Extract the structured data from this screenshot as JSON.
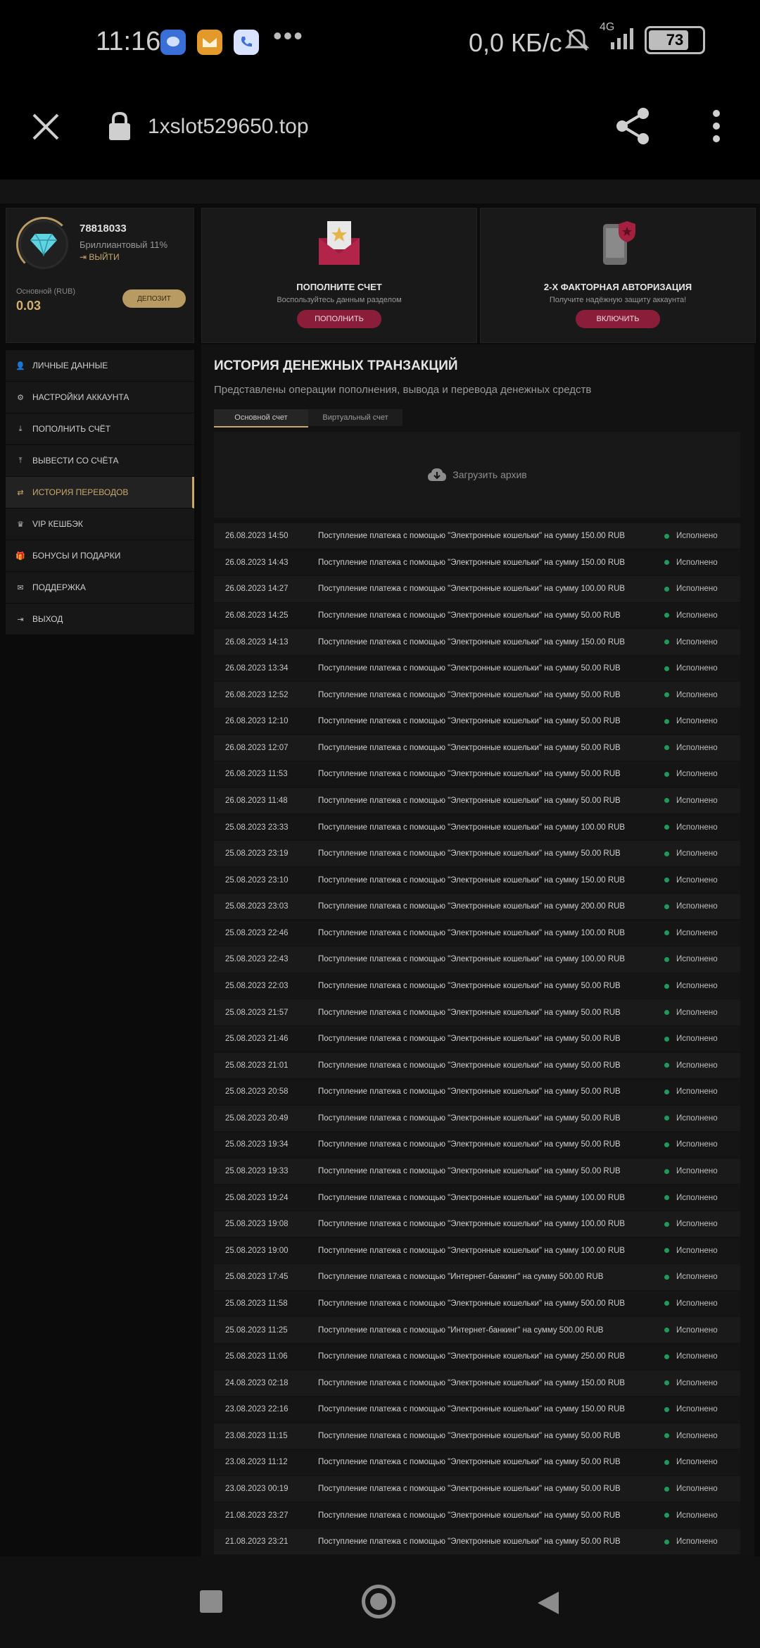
{
  "status_bar": {
    "time": "11:16",
    "network_speed": "0,0 КБ/с",
    "network_type": "4G",
    "battery": "73",
    "more": "•••"
  },
  "browser": {
    "url": "1xslot529650.top"
  },
  "profile": {
    "id": "78818033",
    "level": "Бриллиантовый 11%",
    "logout": "ВЫЙТИ",
    "balance_label": "Основной (RUB)",
    "balance": "0.03",
    "deposit_label": "ДЕПОЗИТ"
  },
  "menu": [
    {
      "label": "ЛИЧНЫЕ ДАННЫЕ",
      "icon": "user-icon",
      "glyph": "👤"
    },
    {
      "label": "НАСТРОЙКИ АККАУНТА",
      "icon": "gears-icon",
      "glyph": "⚙"
    },
    {
      "label": "ПОПОЛНИТЬ СЧЁТ",
      "icon": "download-icon",
      "glyph": "⤓"
    },
    {
      "label": "ВЫВЕСТИ СО СЧЁТА",
      "icon": "upload-icon",
      "glyph": "⤒"
    },
    {
      "label": "ИСТОРИЯ ПЕРЕВОДОВ",
      "icon": "transfer-icon",
      "glyph": "⇄"
    },
    {
      "label": "VIP КЕШБЭК",
      "icon": "crown-icon",
      "glyph": "♛"
    },
    {
      "label": "БОНУСЫ И ПОДАРКИ",
      "icon": "gift-icon",
      "glyph": "🎁"
    },
    {
      "label": "ПОДДЕРЖКА",
      "icon": "mail-icon",
      "glyph": "✉"
    },
    {
      "label": "ВЫХОД",
      "icon": "exit-icon",
      "glyph": "⇥"
    }
  ],
  "promo_deposit": {
    "title": "ПОПОЛНИТЕ СЧЕТ",
    "subtitle": "Воспользуйтесь данным разделом",
    "button": "ПОПОЛНИТЬ"
  },
  "promo_2fa": {
    "title": "2-Х ФАКТОРНАЯ АВТОРИЗАЦИЯ",
    "subtitle": "Получите надёжную защиту аккаунта!",
    "button": "ВКЛЮЧИТЬ"
  },
  "history": {
    "title": "ИСТОРИЯ ДЕНЕЖНЫХ ТРАНЗАКЦИЙ",
    "subtitle": "Представлены операции пополнения, вывода и перевода денежных средств",
    "tabs": [
      "Основной счет",
      "Виртуальный счет"
    ],
    "archive": "Загрузить архив",
    "status_color": "#1f9a5a",
    "rows": [
      {
        "date": "26.08.2023 14:50",
        "desc": "Поступление платежа с помощью \"Электронные кошельки\" на сумму 150.00 RUB",
        "status": "Исполнено"
      },
      {
        "date": "26.08.2023 14:43",
        "desc": "Поступление платежа с помощью \"Электронные кошельки\" на сумму 150.00 RUB",
        "status": "Исполнено"
      },
      {
        "date": "26.08.2023 14:27",
        "desc": "Поступление платежа с помощью \"Электронные кошельки\" на сумму 100.00 RUB",
        "status": "Исполнено"
      },
      {
        "date": "26.08.2023 14:25",
        "desc": "Поступление платежа с помощью \"Электронные кошельки\" на сумму 50.00 RUB",
        "status": "Исполнено"
      },
      {
        "date": "26.08.2023 14:13",
        "desc": "Поступление платежа с помощью \"Электронные кошельки\" на сумму 150.00 RUB",
        "status": "Исполнено"
      },
      {
        "date": "26.08.2023 13:34",
        "desc": "Поступление платежа с помощью \"Электронные кошельки\" на сумму 50.00 RUB",
        "status": "Исполнено"
      },
      {
        "date": "26.08.2023 12:52",
        "desc": "Поступление платежа с помощью \"Электронные кошельки\" на сумму 50.00 RUB",
        "status": "Исполнено"
      },
      {
        "date": "26.08.2023 12:10",
        "desc": "Поступление платежа с помощью \"Электронные кошельки\" на сумму 50.00 RUB",
        "status": "Исполнено"
      },
      {
        "date": "26.08.2023 12:07",
        "desc": "Поступление платежа с помощью \"Электронные кошельки\" на сумму 50.00 RUB",
        "status": "Исполнено"
      },
      {
        "date": "26.08.2023 11:53",
        "desc": "Поступление платежа с помощью \"Электронные кошельки\" на сумму 50.00 RUB",
        "status": "Исполнено"
      },
      {
        "date": "26.08.2023 11:48",
        "desc": "Поступление платежа с помощью \"Электронные кошельки\" на сумму 50.00 RUB",
        "status": "Исполнено"
      },
      {
        "date": "25.08.2023 23:33",
        "desc": "Поступление платежа с помощью \"Электронные кошельки\" на сумму 100.00 RUB",
        "status": "Исполнено"
      },
      {
        "date": "25.08.2023 23:19",
        "desc": "Поступление платежа с помощью \"Электронные кошельки\" на сумму 50.00 RUB",
        "status": "Исполнено"
      },
      {
        "date": "25.08.2023 23:10",
        "desc": "Поступление платежа с помощью \"Электронные кошельки\" на сумму 150.00 RUB",
        "status": "Исполнено"
      },
      {
        "date": "25.08.2023 23:03",
        "desc": "Поступление платежа с помощью \"Электронные кошельки\" на сумму 200.00 RUB",
        "status": "Исполнено"
      },
      {
        "date": "25.08.2023 22:46",
        "desc": "Поступление платежа с помощью \"Электронные кошельки\" на сумму 100.00 RUB",
        "status": "Исполнено"
      },
      {
        "date": "25.08.2023 22:43",
        "desc": "Поступление платежа с помощью \"Электронные кошельки\" на сумму 100.00 RUB",
        "status": "Исполнено"
      },
      {
        "date": "25.08.2023 22:03",
        "desc": "Поступление платежа с помощью \"Электронные кошельки\" на сумму 50.00 RUB",
        "status": "Исполнено"
      },
      {
        "date": "25.08.2023 21:57",
        "desc": "Поступление платежа с помощью \"Электронные кошельки\" на сумму 50.00 RUB",
        "status": "Исполнено"
      },
      {
        "date": "25.08.2023 21:46",
        "desc": "Поступление платежа с помощью \"Электронные кошельки\" на сумму 50.00 RUB",
        "status": "Исполнено"
      },
      {
        "date": "25.08.2023 21:01",
        "desc": "Поступление платежа с помощью \"Электронные кошельки\" на сумму 50.00 RUB",
        "status": "Исполнено"
      },
      {
        "date": "25.08.2023 20:58",
        "desc": "Поступление платежа с помощью \"Электронные кошельки\" на сумму 50.00 RUB",
        "status": "Исполнено"
      },
      {
        "date": "25.08.2023 20:49",
        "desc": "Поступление платежа с помощью \"Электронные кошельки\" на сумму 50.00 RUB",
        "status": "Исполнено"
      },
      {
        "date": "25.08.2023 19:34",
        "desc": "Поступление платежа с помощью \"Электронные кошельки\" на сумму 50.00 RUB",
        "status": "Исполнено"
      },
      {
        "date": "25.08.2023 19:33",
        "desc": "Поступление платежа с помощью \"Электронные кошельки\" на сумму 50.00 RUB",
        "status": "Исполнено"
      },
      {
        "date": "25.08.2023 19:24",
        "desc": "Поступление платежа с помощью \"Электронные кошельки\" на сумму 100.00 RUB",
        "status": "Исполнено"
      },
      {
        "date": "25.08.2023 19:08",
        "desc": "Поступление платежа с помощью \"Электронные кошельки\" на сумму 100.00 RUB",
        "status": "Исполнено"
      },
      {
        "date": "25.08.2023 19:00",
        "desc": "Поступление платежа с помощью \"Электронные кошельки\" на сумму 100.00 RUB",
        "status": "Исполнено"
      },
      {
        "date": "25.08.2023 17:45",
        "desc": "Поступление платежа с помощью \"Интернет-банкинг\" на сумму 500.00 RUB",
        "status": "Исполнено"
      },
      {
        "date": "25.08.2023 11:58",
        "desc": "Поступление платежа с помощью \"Электронные кошельки\" на сумму 500.00 RUB",
        "status": "Исполнено"
      },
      {
        "date": "25.08.2023 11:25",
        "desc": "Поступление платежа с помощью \"Интернет-банкинг\" на сумму 500.00 RUB",
        "status": "Исполнено"
      },
      {
        "date": "25.08.2023 11:06",
        "desc": "Поступление платежа с помощью \"Электронные кошельки\" на сумму 250.00 RUB",
        "status": "Исполнено"
      },
      {
        "date": "24.08.2023 02:18",
        "desc": "Поступление платежа с помощью \"Электронные кошельки\" на сумму 150.00 RUB",
        "status": "Исполнено"
      },
      {
        "date": "23.08.2023 22:16",
        "desc": "Поступление платежа с помощью \"Электронные кошельки\" на сумму 150.00 RUB",
        "status": "Исполнено"
      },
      {
        "date": "23.08.2023 11:15",
        "desc": "Поступление платежа с помощью \"Электронные кошельки\" на сумму 50.00 RUB",
        "status": "Исполнено"
      },
      {
        "date": "23.08.2023 11:12",
        "desc": "Поступление платежа с помощью \"Электронные кошельки\" на сумму 50.00 RUB",
        "status": "Исполнено"
      },
      {
        "date": "23.08.2023 00:19",
        "desc": "Поступление платежа с помощью \"Электронные кошельки\" на сумму 50.00 RUB",
        "status": "Исполнено"
      },
      {
        "date": "21.08.2023 23:27",
        "desc": "Поступление платежа с помощью \"Электронные кошельки\" на сумму 50.00 RUB",
        "status": "Исполнено"
      },
      {
        "date": "21.08.2023 23:21",
        "desc": "Поступление платежа с помощью \"Электронные кошельки\" на сумму 50.00 RUB",
        "status": "Исполнено"
      }
    ]
  }
}
